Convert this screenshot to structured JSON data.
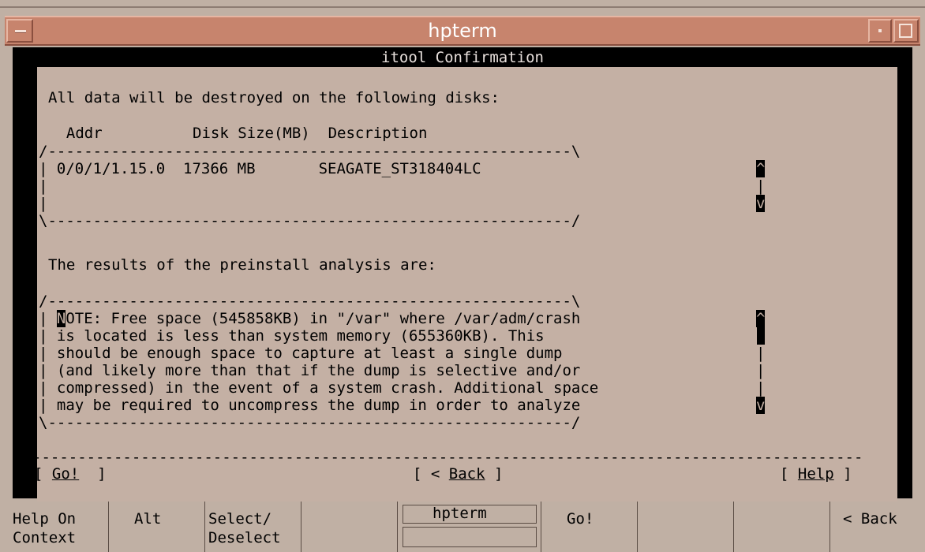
{
  "window": {
    "title": "hpterm"
  },
  "terminal": {
    "title": "itool Confirmation",
    "dialog": {
      "heading": "All data will be destroyed on the following disks:",
      "disk_table": {
        "header": "  Addr          Disk Size(MB)  Description",
        "top_border": "/----------------------------------------------------------\\",
        "rows": [
          "| 0/0/1/1.15.0  17366 MB       SEAGATE_ST318404LC",
          "|",
          "|"
        ],
        "bottom_border": "\\----------------------------------------------------------/",
        "scroll_up": "^",
        "scroll_down": "v"
      },
      "results_heading": "The results of the preinstall analysis are:",
      "analysis": {
        "top_border": "/----------------------------------------------------------\\",
        "cursor_char": "N",
        "lines": [
          "OTE: Free space (545858KB) in \"/var\" where /var/adm/crash",
          "| is located is less than system memory (655360KB). This",
          "| should be enough space to capture at least a single dump",
          "| (and likely more than that if the dump is selective and/or",
          "| compressed) in the event of a system crash. Additional space",
          "| may be required to uncompress the dump in order to analyze"
        ],
        "bottom_border": "\\----------------------------------------------------------/",
        "scroll_up": "^",
        "scroll_down": "v"
      },
      "separator": "-----------------------------------------------------------------",
      "buttons": {
        "go": {
          "open": "[ ",
          "label": "Go!",
          "close": "  ]"
        },
        "back": {
          "open": "[ < ",
          "label": "Back",
          "close": " ]"
        },
        "help": {
          "open": "[ ",
          "label": "Help",
          "close": " ]"
        }
      }
    }
  },
  "softkeys": [
    {
      "line1": "Help On",
      "line2": "Context"
    },
    {
      "line1": "Alt",
      "line2": ""
    },
    {
      "line1": "Select/",
      "line2": "Deselect"
    },
    {
      "line1": "",
      "line2": ""
    },
    {
      "line1": "hpterm",
      "line2": ""
    },
    {
      "line1": "Go!",
      "line2": ""
    },
    {
      "line1": "",
      "line2": ""
    },
    {
      "line1": "",
      "line2": ""
    },
    {
      "line1": "< Back",
      "line2": ""
    }
  ]
}
